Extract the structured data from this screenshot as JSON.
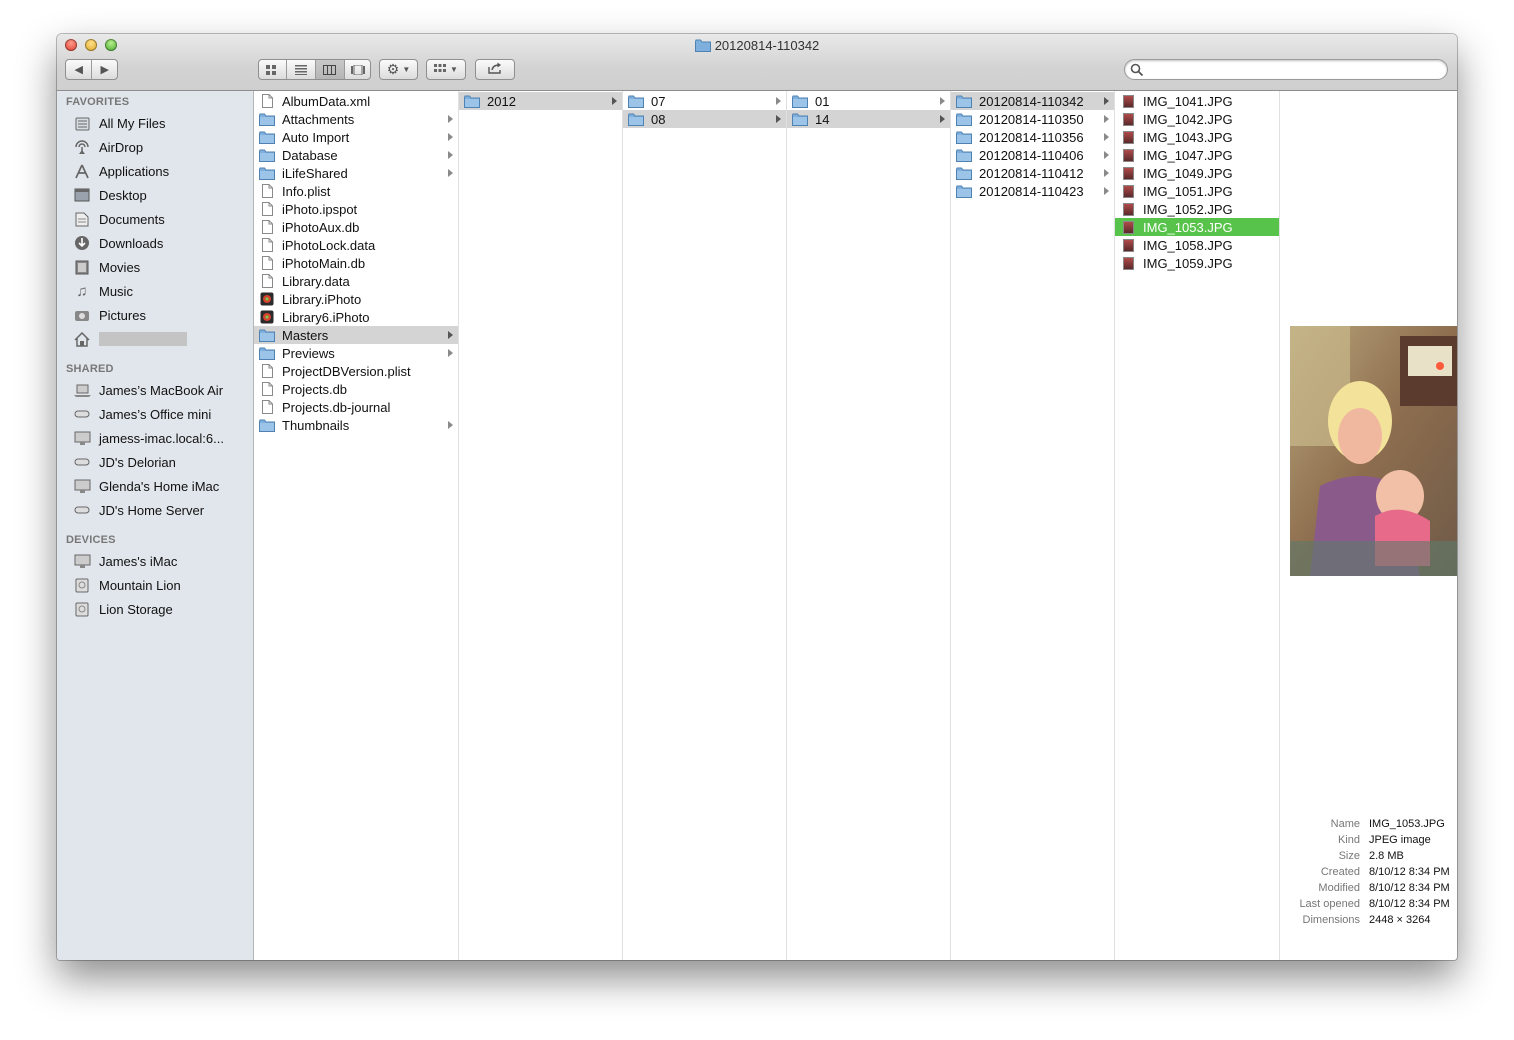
{
  "window": {
    "title": "20120814-110342"
  },
  "toolbar": {
    "back_icon": "back-arrow-icon",
    "forward_icon": "forward-arrow-icon",
    "view_modes": [
      "icon-view",
      "list-view",
      "column-view",
      "coverflow-view"
    ],
    "active_view": "column-view",
    "search_placeholder": ""
  },
  "sidebar": {
    "favorites_label": "FAVORITES",
    "favorites": [
      {
        "label": "All My Files",
        "icon": "all-files-icon"
      },
      {
        "label": "AirDrop",
        "icon": "airdrop-icon"
      },
      {
        "label": "Applications",
        "icon": "applications-icon"
      },
      {
        "label": "Desktop",
        "icon": "desktop-icon"
      },
      {
        "label": "Documents",
        "icon": "documents-icon"
      },
      {
        "label": "Downloads",
        "icon": "downloads-icon"
      },
      {
        "label": "Movies",
        "icon": "movies-icon"
      },
      {
        "label": "Music",
        "icon": "music-icon"
      },
      {
        "label": "Pictures",
        "icon": "pictures-icon"
      }
    ],
    "shared_label": "SHARED",
    "shared": [
      {
        "label": "James’s MacBook Air",
        "icon": "laptop-icon"
      },
      {
        "label": "James’s Office mini",
        "icon": "mac-mini-icon"
      },
      {
        "label": "jamess-imac.local:6...",
        "icon": "display-icon"
      },
      {
        "label": "JD's Delorian",
        "icon": "server-icon"
      },
      {
        "label": "Glenda's Home iMac",
        "icon": "display-icon"
      },
      {
        "label": "JD's Home Server",
        "icon": "server-icon"
      }
    ],
    "devices_label": "DEVICES",
    "devices": [
      {
        "label": "James's iMac",
        "icon": "display-icon"
      },
      {
        "label": "Mountain Lion",
        "icon": "drive-icon"
      },
      {
        "label": "Lion Storage",
        "icon": "drive-icon"
      }
    ]
  },
  "columns": [
    {
      "items": [
        {
          "label": "AlbumData.xml",
          "type": "file"
        },
        {
          "label": "Attachments",
          "type": "folder"
        },
        {
          "label": "Auto Import",
          "type": "folder"
        },
        {
          "label": "Database",
          "type": "folder"
        },
        {
          "label": "iLifeShared",
          "type": "folder"
        },
        {
          "label": "Info.plist",
          "type": "file"
        },
        {
          "label": "iPhoto.ipspot",
          "type": "file"
        },
        {
          "label": "iPhotoAux.db",
          "type": "file"
        },
        {
          "label": "iPhotoLock.data",
          "type": "file"
        },
        {
          "label": "iPhotoMain.db",
          "type": "file"
        },
        {
          "label": "Library.data",
          "type": "file"
        },
        {
          "label": "Library.iPhoto",
          "type": "app"
        },
        {
          "label": "Library6.iPhoto",
          "type": "app"
        },
        {
          "label": "Masters",
          "type": "folder",
          "path": true
        },
        {
          "label": "Previews",
          "type": "folder"
        },
        {
          "label": "ProjectDBVersion.plist",
          "type": "file"
        },
        {
          "label": "Projects.db",
          "type": "file"
        },
        {
          "label": "Projects.db-journal",
          "type": "file"
        },
        {
          "label": "Thumbnails",
          "type": "folder"
        }
      ]
    },
    {
      "items": [
        {
          "label": "2012",
          "type": "folder",
          "path": true
        }
      ]
    },
    {
      "items": [
        {
          "label": "07",
          "type": "folder"
        },
        {
          "label": "08",
          "type": "folder",
          "path": true
        }
      ]
    },
    {
      "items": [
        {
          "label": "01",
          "type": "folder"
        },
        {
          "label": "14",
          "type": "folder",
          "path": true
        }
      ]
    },
    {
      "items": [
        {
          "label": "20120814-110342",
          "type": "folder",
          "path": true
        },
        {
          "label": "20120814-110350",
          "type": "folder"
        },
        {
          "label": "20120814-110356",
          "type": "folder"
        },
        {
          "label": "20120814-110406",
          "type": "folder"
        },
        {
          "label": "20120814-110412",
          "type": "folder"
        },
        {
          "label": "20120814-110423",
          "type": "folder"
        }
      ]
    },
    {
      "items": [
        {
          "label": "IMG_1041.JPG",
          "type": "image"
        },
        {
          "label": "IMG_1042.JPG",
          "type": "image"
        },
        {
          "label": "IMG_1043.JPG",
          "type": "image"
        },
        {
          "label": "IMG_1047.JPG",
          "type": "image"
        },
        {
          "label": "IMG_1049.JPG",
          "type": "image"
        },
        {
          "label": "IMG_1051.JPG",
          "type": "image"
        },
        {
          "label": "IMG_1052.JPG",
          "type": "image"
        },
        {
          "label": "IMG_1053.JPG",
          "type": "image",
          "selected": true
        },
        {
          "label": "IMG_1058.JPG",
          "type": "image"
        },
        {
          "label": "IMG_1059.JPG",
          "type": "image"
        }
      ]
    }
  ],
  "preview": {
    "info": [
      {
        "label": "Name",
        "value": "IMG_1053.JPG"
      },
      {
        "label": "Kind",
        "value": "JPEG image"
      },
      {
        "label": "Size",
        "value": "2.8 MB"
      },
      {
        "label": "Created",
        "value": "8/10/12 8:34 PM"
      },
      {
        "label": "Modified",
        "value": "8/10/12 8:34 PM"
      },
      {
        "label": "Last opened",
        "value": "8/10/12 8:34 PM"
      },
      {
        "label": "Dimensions",
        "value": "2448 × 3264"
      }
    ]
  },
  "colors": {
    "selection": "#58c34a",
    "path_highlight": "#d4d4d4",
    "sidebar_bg": "#e1e6ec",
    "folder": "#7fb0dd"
  }
}
